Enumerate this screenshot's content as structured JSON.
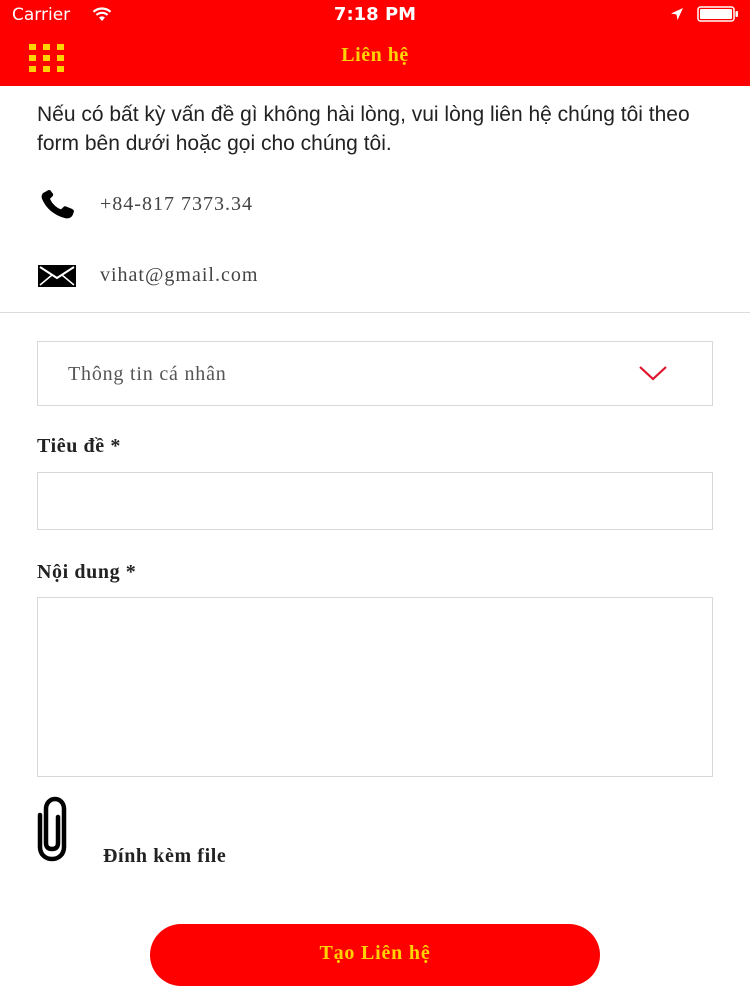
{
  "status_bar": {
    "carrier": "Carrier",
    "time": "7:18 PM",
    "icons": [
      "wifi-icon",
      "location-arrow-icon",
      "battery-icon"
    ]
  },
  "nav": {
    "menu_icon": "grid-menu-icon",
    "title": "Liên hệ"
  },
  "intro": "Nếu có bất kỳ vấn đề gì không hài lòng, vui lòng liên hệ chúng tôi theo form bên dưới hoặc gọi cho chúng tôi.",
  "contact": {
    "phone": "+84-817 7373.34",
    "email": "vihat@gmail.com"
  },
  "form": {
    "category_selected": "Thông tin cá nhân",
    "subject_label": "Tiêu đề *",
    "subject_value": "",
    "content_label": "Nội dung *",
    "content_value": "",
    "attach_label": "Đính kèm file",
    "submit_label": "Tạo Liên hệ"
  },
  "colors": {
    "brand_red": "#ff0000",
    "brand_yellow": "#ffd200"
  }
}
